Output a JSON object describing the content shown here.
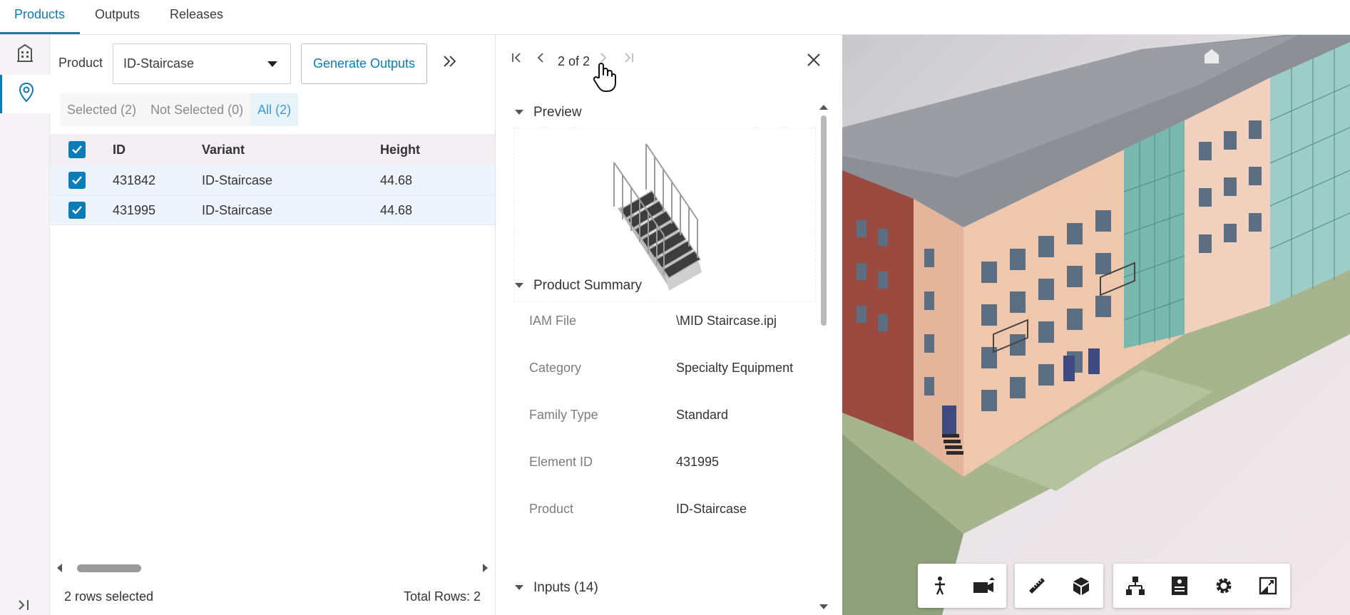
{
  "tabs": [
    {
      "label": "Products",
      "active": true
    },
    {
      "label": "Outputs",
      "active": false
    },
    {
      "label": "Releases",
      "active": false
    }
  ],
  "rail": {
    "items": [
      {
        "icon": "building-icon",
        "active": false
      },
      {
        "icon": "location-pin-icon",
        "active": true
      }
    ],
    "collapse_icon": "expand-panel-icon"
  },
  "product_panel": {
    "product_label": "Product",
    "product_value": "ID-Staircase",
    "generate_button": "Generate Outputs",
    "expand_icon": "double-chevron-right-icon",
    "filters": [
      {
        "label": "Selected (2)",
        "active": false
      },
      {
        "label": "Not Selected (0)",
        "active": false
      },
      {
        "label": "All (2)",
        "active": true
      }
    ],
    "columns": [
      "ID",
      "Variant",
      "Height"
    ],
    "rows": [
      {
        "id": "431842",
        "variant": "ID-Staircase",
        "height": "44.68",
        "checked": true
      },
      {
        "id": "431995",
        "variant": "ID-Staircase",
        "height": "44.68",
        "checked": true
      }
    ],
    "footer_left": "2 rows selected",
    "footer_right": "Total Rows: 2"
  },
  "detail": {
    "pager_text": "2 of 2",
    "sections": {
      "preview": "Preview",
      "summary": "Product Summary",
      "inputs": "Inputs (14)"
    },
    "summary_fields": [
      {
        "key": "IAM File",
        "value": "\\MID Staircase.ipj"
      },
      {
        "key": "Category",
        "value": "Specialty Equipment"
      },
      {
        "key": "Family Type",
        "value": "Standard"
      },
      {
        "key": "Element ID",
        "value": "431995"
      },
      {
        "key": "Product",
        "value": "ID-Staircase"
      }
    ]
  },
  "viewer": {
    "toolbar_groups": [
      [
        "walk-icon",
        "camera-icon"
      ],
      [
        "measure-icon",
        "section-box-icon"
      ],
      [
        "model-browser-icon",
        "properties-icon",
        "settings-icon",
        "fullscreen-icon"
      ]
    ]
  },
  "colors": {
    "accent": "#0b7cb5",
    "row_selected": "#eef4fb"
  }
}
